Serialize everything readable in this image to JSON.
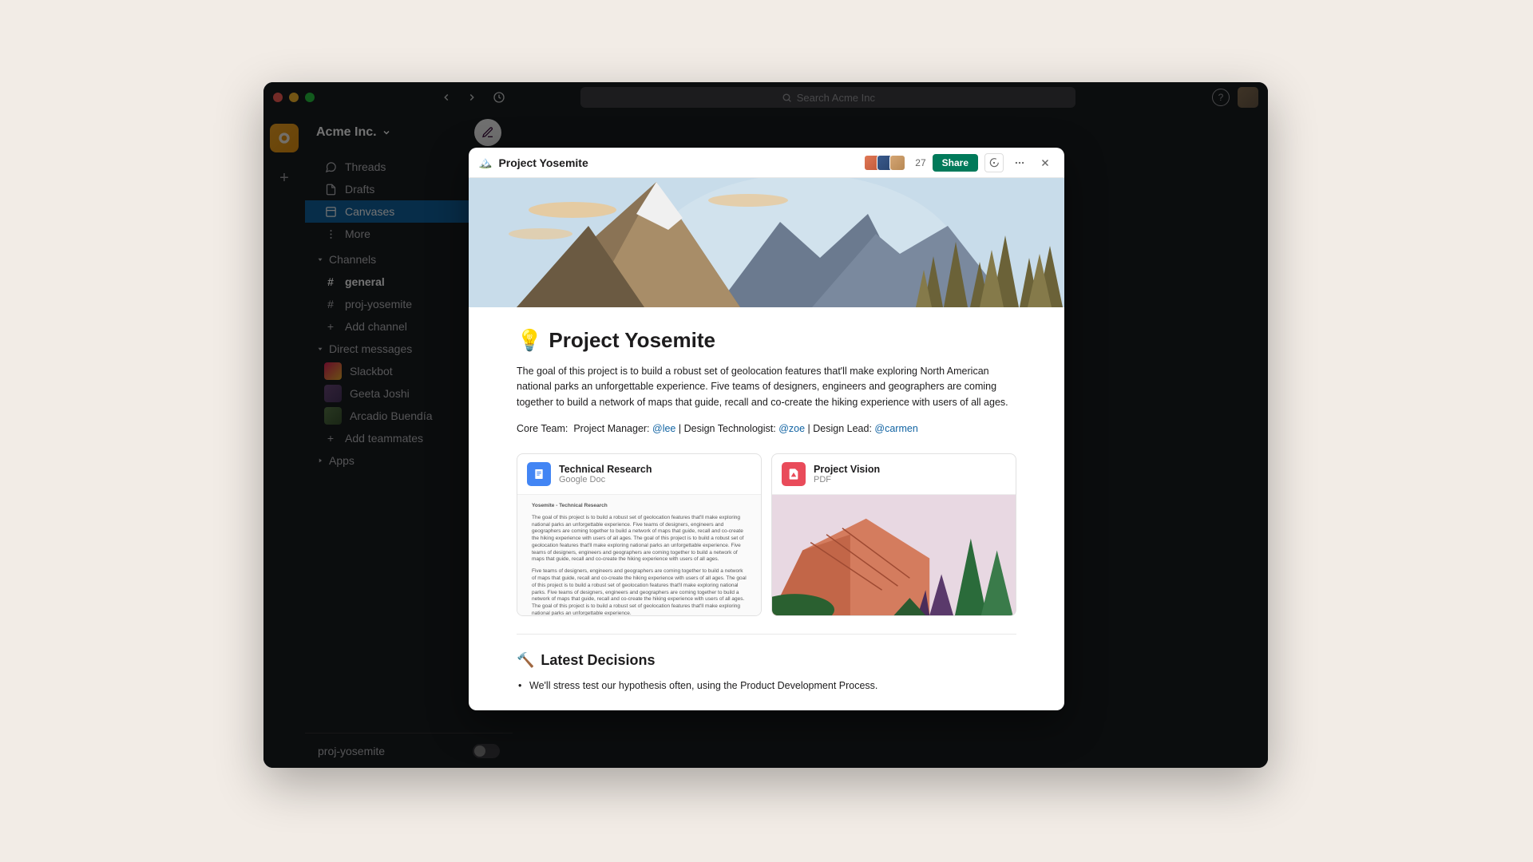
{
  "titlebar": {
    "search_placeholder": "Search Acme Inc"
  },
  "workspace": {
    "name": "Acme Inc."
  },
  "sidebar": {
    "nav": {
      "threads": "Threads",
      "drafts": "Drafts",
      "canvases": "Canvases",
      "more": "More"
    },
    "channels_heading": "Channels",
    "channels": [
      {
        "name": "general",
        "bold": true
      },
      {
        "name": "proj-yosemite",
        "bold": false
      }
    ],
    "add_channel": "Add channel",
    "dms_heading": "Direct messages",
    "dms": [
      {
        "name": "Slackbot"
      },
      {
        "name": "Geeta Joshi"
      },
      {
        "name": "Arcadio Buendía"
      }
    ],
    "add_teammates": "Add teammates",
    "apps_heading": "Apps",
    "footer_channel": "proj-yosemite"
  },
  "canvas": {
    "header": {
      "title": "Project Yosemite",
      "member_count": "27",
      "share_label": "Share"
    },
    "doc": {
      "h1_emoji": "💡",
      "h1": "Project Yosemite",
      "intro": "The goal of this project is to build a robust set of geolocation features that'll make exploring North American national parks an unforgettable experience. Five teams of designers, engineers and geographers are coming together to build a network of maps that guide, recall and co-create the hiking experience with users of all ages.",
      "core_team_label": "Core Team:",
      "pm_label": "Project Manager:",
      "pm_mention": "@lee",
      "dt_label": "Design Technologist:",
      "dt_mention": "@zoe",
      "dl_label": "Design Lead:",
      "dl_mention": "@carmen",
      "attachments": [
        {
          "title": "Technical Research",
          "subtitle": "Google Doc",
          "type": "doc"
        },
        {
          "title": "Project Vision",
          "subtitle": "PDF",
          "type": "pdf"
        }
      ],
      "preview_heading": "Yosemite - Technical Research",
      "preview_p1": "The goal of this project is to build a robust set of geolocation features that'll make exploring national parks an unforgettable experience. Five teams of designers, engineers and geographers are coming together to build a network of maps that guide, recall and co-create the hiking experience with users of all ages. The goal of this project is to build a robust set of geolocation features that'll make exploring national parks an unforgettable experience. Five teams of designers, engineers and geographers are coming together to build a network of maps that guide, recall and co-create the hiking experience with users of all ages.",
      "preview_p2": "Five teams of designers, engineers and geographers are coming together to build a network of maps that guide, recall and co-create the hiking experience with users of all ages. The goal of this project is to build a robust set of geolocation features that'll make exploring national parks. Five teams of designers, engineers and geographers are coming together to build a network of maps that guide, recall and co-create the hiking experience with users of all ages. The goal of this project is to build a robust set of geolocation features that'll make exploring national parks an unforgettable experience.",
      "h2_emoji": "🔨",
      "h2": "Latest Decisions",
      "decision_1": "We'll stress test our hypothesis often, using the  Product Development Process."
    }
  }
}
